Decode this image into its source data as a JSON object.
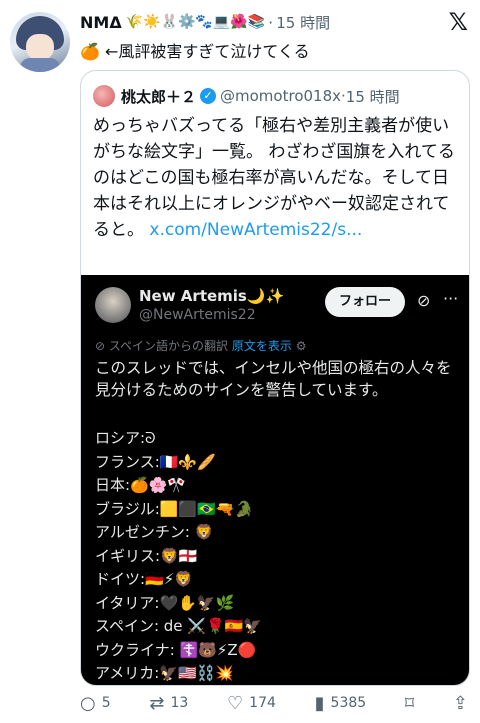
{
  "post": {
    "author_name": "NMΔ",
    "author_emojis": "🌾☀️🐰⚙️🐾💻🌺📚",
    "time": "15 時間",
    "text": "🍊 ←風評被害すぎて泣けてくる"
  },
  "quote": {
    "author_name": "桃太郎＋２",
    "handle": "@momotro018x",
    "time": "15 時間",
    "body_text": "めっちゃバズってる「極右や差別主義者が使いがちな絵文字」一覧。 わざわざ国旗を入れてるのはどこの国も極右率が高いんだな。そして日本はそれ以上にオレンジがやベー奴認定されてると。",
    "link": "x.com/NewArtemis22/s..."
  },
  "embedded": {
    "name": "New Artemis🌙✨",
    "handle": "@NewArtemis22",
    "follow_label": "フォロー",
    "translation_note": "スペイン語からの翻訳",
    "show_original": "原文を表示",
    "text": "このスレッドでは、インセルや他国の極右の人々を見分けるためのサインを警告しています。",
    "rows": [
      "ロシア:ᘐ",
      "フランス:🇫🇷⚜️🥖",
      "日本:🍊🌸🎌",
      "ブラジル:🟨⬛🇧🇷🔫🐊",
      "アルゼンチン: 🦁",
      "イギリス:🦁🏴󠁧󠁢󠁥󠁮󠁧󠁿",
      "ドイツ:🇩🇪⚡🦁",
      "イタリア:🖤✋🦅🌿",
      "スペイン: de ⚔️🌹🇪🇸🦅",
      "ウクライナ: ☦️🐻⚡Z🔴",
      "アメリカ:🦅🇺🇸⛓️💥"
    ]
  },
  "actions": {
    "replies": "5",
    "reposts": "13",
    "likes": "174",
    "views": "5385"
  },
  "colors": {
    "link": "#1d9bf0",
    "muted": "#536471",
    "media_bg": "#000000"
  },
  "icons": {
    "x_logo": "x-logo-icon",
    "verified": "verified-badge-icon",
    "reply": "reply-icon",
    "repost": "repost-icon",
    "like": "heart-icon",
    "views": "views-icon",
    "bookmark": "bookmark-icon",
    "share": "share-icon"
  }
}
